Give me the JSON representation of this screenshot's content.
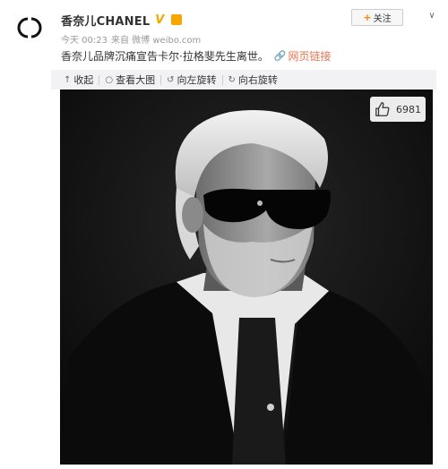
{
  "post": {
    "author_name": "香奈儿CHANEL",
    "timestamp": "今天 00:23",
    "source": "来自 微博 weibo.com",
    "text": "香奈儿品牌沉痛宣告卡尔·拉格斐先生离世。",
    "web_link_label": "网页链接"
  },
  "actions": {
    "follow_label": "关注",
    "follow_plus": "+",
    "more_glyph": "∨"
  },
  "toolbar": {
    "items": [
      {
        "label": "收起",
        "icon": "collapse-icon",
        "glyph": "↑"
      },
      {
        "label": "查看大图",
        "icon": "zoom-icon",
        "glyph": "○"
      },
      {
        "label": "向左旋转",
        "icon": "rotate-left-icon",
        "glyph": "↺"
      },
      {
        "label": "向右旋转",
        "icon": "rotate-right-icon",
        "glyph": "↻"
      }
    ]
  },
  "photo": {
    "like_count": "6981",
    "icon": "thumbs-up-icon",
    "description_icon": "portrait-photo"
  },
  "colors": {
    "accent": "#eb7350",
    "verified": "#f7a600",
    "toolbar_bg": "#f2f2f5",
    "photo_bg": "#121212"
  }
}
